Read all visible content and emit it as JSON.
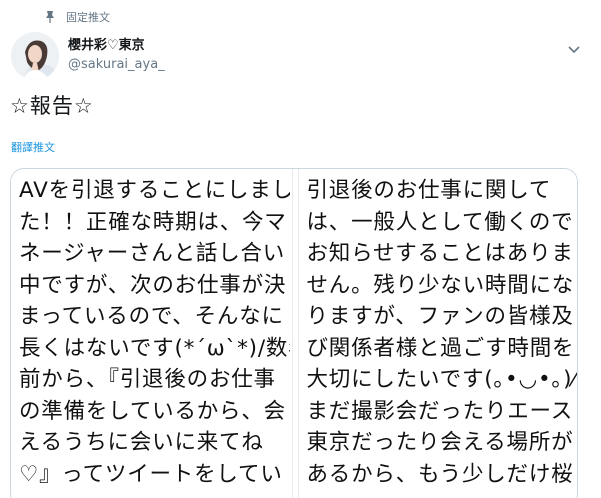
{
  "pinned": {
    "label": "固定推文",
    "icon": "pin-icon"
  },
  "user": {
    "display_name": "櫻井彩♡東京",
    "handle": "@sakurai_aya_"
  },
  "tweet": {
    "text": "☆報告☆",
    "translate_label": "翻譯推文"
  },
  "media": {
    "left_lines": [
      "AVを引退することにしまし",
      "た！！正確な時期は、今マ",
      "ネージャーさんと話し合い",
      "中ですが、次のお仕事が決",
      "まっているので、そんなに",
      "長くはないです(*´ω`*)/数年",
      "前から、『引退後のお仕事",
      "の準備をしているから、会",
      "えるうちに会いに来てね",
      "♡』ってツイートをしてい"
    ],
    "right_lines": [
      "引退後のお仕事に関して",
      "は、一般人として働くので",
      "お知らせすることはありま",
      "せん。残り少ない時間にな",
      "りますが、ファンの皆様及",
      "び関係者様と過ごす時間を",
      "大切にしたいです(｡•◡•｡)⁄⋆",
      "まだ撮影会だったりエース",
      "東京だったり会える場所が",
      "あるから、もう少しだけ桜"
    ]
  },
  "icons": {
    "caret": "chevron-down-icon",
    "avatar": "avatar"
  }
}
